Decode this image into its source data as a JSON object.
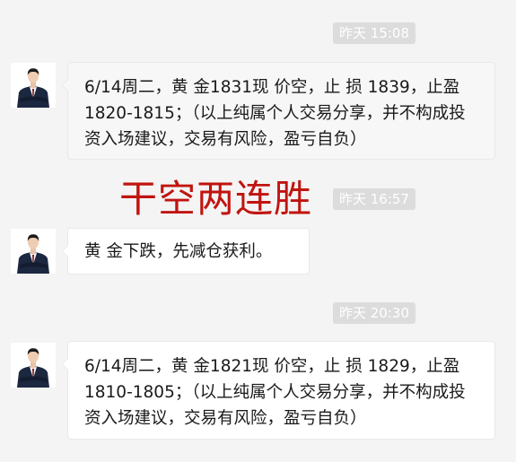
{
  "chat": {
    "timestamps": [
      "昨天 15:08",
      "昨天 16:57",
      "昨天 20:30"
    ],
    "messages": [
      {
        "text": "6/14周二，黄 金1831现 价空，止 损 1839，止盈1820-1815；（以上纯属个人交易分享，并不构成投资入场建议，交易有风险，盈亏自负）"
      },
      {
        "text": "黄 金下跌，先减仓获利。"
      },
      {
        "text": "6/14周二，黄 金1821现 价空，止 损 1829，止盈1810-1805；（以上纯属个人交易分享，并不构成投资入场建议，交易有风险，盈亏自负）"
      }
    ],
    "overlay_text": "干空两连胜"
  },
  "colors": {
    "background": "#f4f4f4",
    "timestamp_bg": "#dcdcdc",
    "overlay_red": "#c1140f",
    "suit": "#1c2740"
  },
  "icons": {
    "avatar": "person-in-suit-avatar"
  }
}
